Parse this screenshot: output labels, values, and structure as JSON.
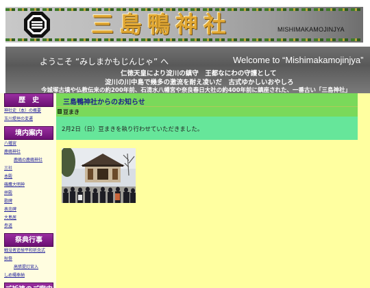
{
  "header": {
    "title": "三島鴨神社",
    "roman": "MISHIMAKAMOJINJYA",
    "crest_icon": "shrine-crest-icon"
  },
  "welcome": {
    "ja": "ようこそ “みしまかもじんじゃ” へ",
    "en": "Welcome to “Mishimakamojinjya”",
    "line1": "仁徳天皇により淀川の鎮守　王都なにわの守護として",
    "line2": "淀川の川中島で幾多の激流を耐え凌いだ　古式ゆかしいおやしろ",
    "line3": "今城塚古墳や仏教伝来の約200年前、石清水八幡宮や奈良春日大社の約400年前に鎮座された、一番古い「三島神社」"
  },
  "sidebar": {
    "sections": [
      {
        "heading": "歴　史",
        "links": [
          {
            "label": "神社史（本）の概要",
            "indent": false
          },
          {
            "label": "玉川堤垣の変遷",
            "indent": false
          }
        ]
      },
      {
        "heading": "境内案内",
        "links": [
          {
            "label": "八幡宮",
            "indent": false
          },
          {
            "label": "鹿嶋神社",
            "indent": false
          },
          {
            "label": "鹿嶋の鹿嶋神社",
            "indent": true
          },
          {
            "label": "三社",
            "indent": false
          },
          {
            "label": "本殿",
            "indent": false
          },
          {
            "label": "磯鷹大明神",
            "indent": false
          },
          {
            "label": "拝殿",
            "indent": false
          },
          {
            "label": "歌碑",
            "indent": false
          },
          {
            "label": "表忠碑",
            "indent": false
          },
          {
            "label": "大島居",
            "indent": false
          },
          {
            "label": "参道",
            "indent": false
          }
        ]
      },
      {
        "heading": "祭典行事",
        "links": [
          {
            "label": "戦没者追悼平和祈念式",
            "indent": false
          },
          {
            "label": "秋祭",
            "indent": false
          },
          {
            "label": "高張提灯宮入",
            "indent": true
          },
          {
            "label": "しめ縄奉納",
            "indent": false
          }
        ]
      },
      {
        "heading": "ご祈祷のご案内",
        "links": []
      }
    ]
  },
  "notice": {
    "bar_title": "三島鴨神社からのお知らせ",
    "post_title": "豆まき",
    "post_body": "2月2日（日）豆まきを執り行わせていただきました。"
  },
  "colors": {
    "sidebar_heading": "#6b0f73",
    "notice_bar": "#7ad95a",
    "post_body": "#66e69a",
    "content_bg": "#ffffa0",
    "title_gold": "#e0a733"
  }
}
